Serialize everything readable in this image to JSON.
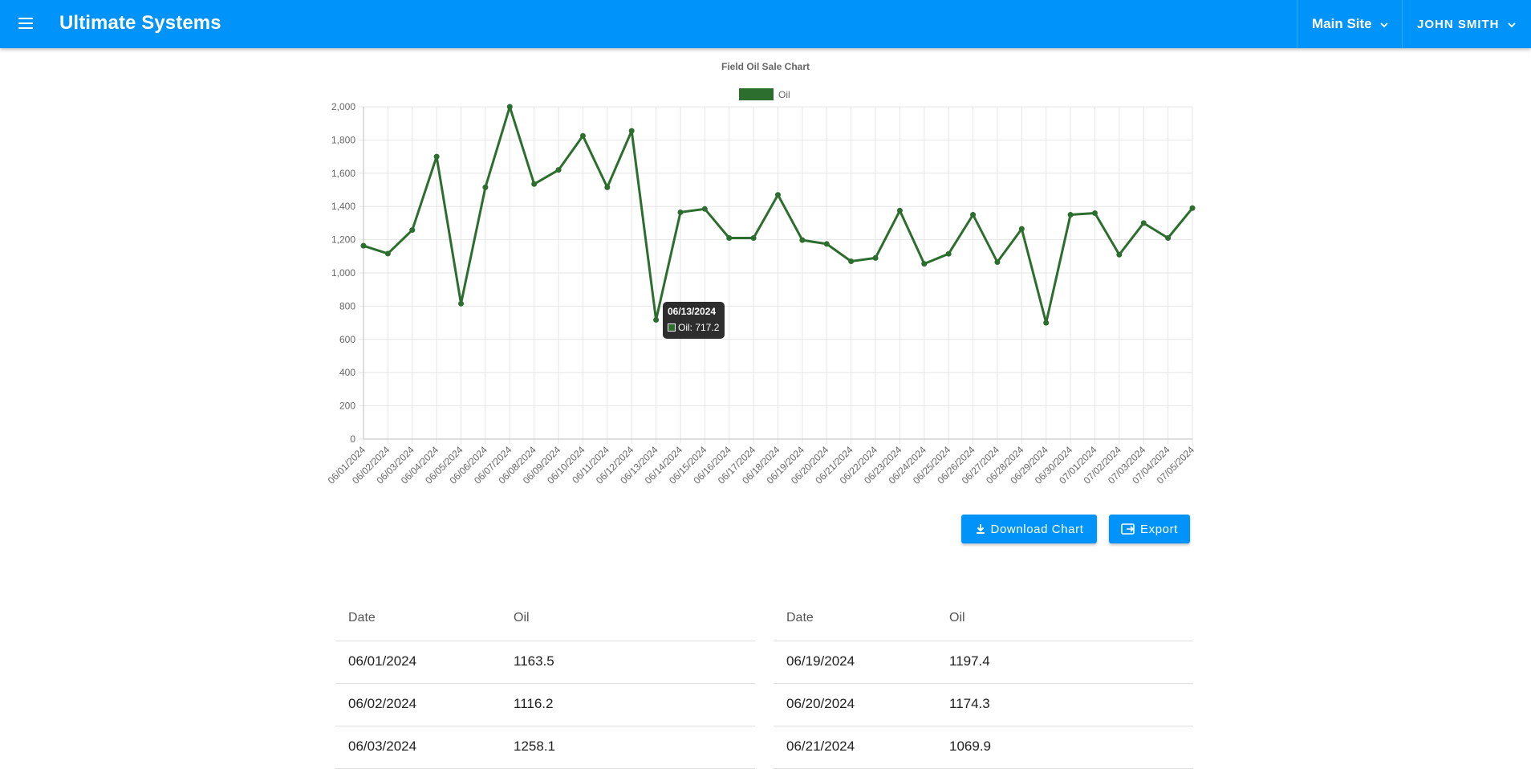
{
  "header": {
    "app_title": "Ultimate Systems",
    "site_selector": "Main Site",
    "user_menu": "JOHN SMITH"
  },
  "chart_title": "Field Oil Sale Chart",
  "chart_data": {
    "type": "line",
    "title": "Field Oil Sale Chart",
    "categories": [
      "06/01/2024",
      "06/02/2024",
      "06/03/2024",
      "06/04/2024",
      "06/05/2024",
      "06/06/2024",
      "06/07/2024",
      "06/08/2024",
      "06/09/2024",
      "06/10/2024",
      "06/11/2024",
      "06/12/2024",
      "06/13/2024",
      "06/14/2024",
      "06/15/2024",
      "06/16/2024",
      "06/17/2024",
      "06/18/2024",
      "06/19/2024",
      "06/20/2024",
      "06/21/2024",
      "06/22/2024",
      "06/23/2024",
      "06/24/2024",
      "06/25/2024",
      "06/26/2024",
      "06/27/2024",
      "06/28/2024",
      "06/29/2024",
      "06/30/2024",
      "07/01/2024",
      "07/02/2024",
      "07/03/2024",
      "07/04/2024",
      "07/05/2024"
    ],
    "tick_labels": [
      "06/01/2024",
      "06/02/2024",
      "06/03/2024",
      "06/04/2024",
      "06/05/2024",
      "06/06/2024",
      "06/07/2024",
      "06/08/2024",
      "06/09/2024",
      "06/10/2024",
      "06/11/2024",
      "06/12/2024",
      "06/13/2024",
      "06/14/2024",
      "06/15/2024",
      "06/16/2024",
      "06/17/2024",
      "06/18/2024",
      "06/19/2024",
      "06/20/2024",
      "06/21/2024",
      "06/22/2024",
      "06/23/2024",
      "06/24/2024",
      "06/25/2024",
      "06/26/2024",
      "06/27/2024",
      "06/28/2024",
      "06/29/2024",
      "06/30/2024",
      "07/01/2024",
      "07/02/2024",
      "07/03/2024",
      "07/04/2024",
      "07/05/2024"
    ],
    "series": [
      {
        "name": "Oil",
        "color": "#2c6e2d",
        "values": [
          1163.5,
          1116.2,
          1258.1,
          1700,
          815,
          1515,
          2000,
          1535,
          1620,
          1825,
          1515,
          1855,
          717.2,
          1365,
          1385,
          1210,
          1210,
          1470,
          1197.4,
          1174.3,
          1069.9,
          1090,
          1375,
          1055,
          1115,
          1350,
          1065,
          1265,
          700,
          1350,
          1360,
          1110,
          1300,
          1210,
          1390
        ]
      }
    ],
    "ylim": [
      0,
      2000
    ],
    "y_ticks": [
      "0",
      "200",
      "400",
      "600",
      "800",
      "1,000",
      "1,200",
      "1,400",
      "1,600",
      "1,800",
      "2,000"
    ],
    "y_tick_values": [
      0,
      200,
      400,
      600,
      800,
      1000,
      1200,
      1400,
      1600,
      1800,
      2000
    ],
    "grid": true,
    "legend": "top-center"
  },
  "tooltip": {
    "title": "06/13/2024",
    "label": "Oil: 717.2"
  },
  "buttons": {
    "download": "Download Chart",
    "export": "Export"
  },
  "tables": [
    {
      "headers": [
        "Date",
        "Oil"
      ],
      "rows": [
        [
          "06/01/2024",
          "1163.5"
        ],
        [
          "06/02/2024",
          "1116.2"
        ],
        [
          "06/03/2024",
          "1258.1"
        ]
      ]
    },
    {
      "headers": [
        "Date",
        "Oil"
      ],
      "rows": [
        [
          "06/19/2024",
          "1197.4"
        ],
        [
          "06/20/2024",
          "1174.3"
        ],
        [
          "06/21/2024",
          "1069.9"
        ]
      ]
    }
  ]
}
